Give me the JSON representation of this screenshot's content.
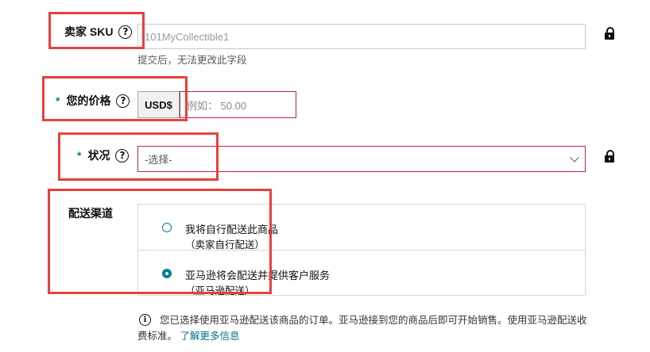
{
  "sku": {
    "label": "卖家 SKU",
    "value": "101MyCollectible1",
    "hint": "提交后，无法更改此字段",
    "help_icon": "question-circle-icon",
    "lock_icon": "lock-icon"
  },
  "price": {
    "required_mark": "*",
    "label": "您的价格",
    "currency": "USD$",
    "placeholder": "例如： 50.00"
  },
  "condition": {
    "required_mark": "*",
    "label": "状况",
    "selected": "-选择-"
  },
  "fulfillment": {
    "label": "配送渠道",
    "options": [
      {
        "title": "我将自行配送此商品",
        "subtitle": "（卖家自行配送）",
        "selected": false
      },
      {
        "title": "亚马逊将会配送并提供客户服务",
        "subtitle": "（亚马逊配送）",
        "selected": true
      }
    ]
  },
  "notice": {
    "text": "您已选择使用亚马逊配送该商品的订单。亚马逊接到您的商品后即可开始销售。使用亚马逊配送收费标准。",
    "link": "了解更多信息"
  },
  "colors": {
    "accent": "#008296",
    "error_border": "#b3283b",
    "highlight_box": "#e8403b"
  }
}
